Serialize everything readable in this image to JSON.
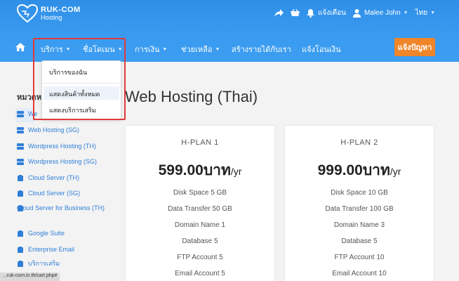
{
  "brand": {
    "name": "RUK-COM",
    "sub": "Hosting"
  },
  "topbar": {
    "notify_label": "แจ้งเตือน",
    "user_name": "Malee John",
    "language": "ไทย"
  },
  "nav": {
    "items": [
      {
        "label": "บริการ"
      },
      {
        "label": "ชื่อโดเมน"
      },
      {
        "label": "การเงิน"
      },
      {
        "label": "ช่วยเหลือ"
      },
      {
        "label": "สร้างรายได้กับเรา"
      },
      {
        "label": "แจ้งโอนเงิน"
      }
    ],
    "cta_label": "แจ้งปัญหา"
  },
  "dropdown": {
    "items": [
      {
        "label": "บริการของฉัน"
      },
      {
        "label": "แสดงสินค้าทั้งหมด"
      },
      {
        "label": "แสดงบริการเสริม"
      }
    ]
  },
  "sidebar": {
    "title": "หมวดหมู่",
    "items": [
      {
        "label": "We"
      },
      {
        "label": "Web Hosting (SG)"
      },
      {
        "label": "Wordpress Hosting (TH)"
      },
      {
        "label": "Wordpress Hosting (SG)"
      },
      {
        "label": "Cloud Server (TH)"
      },
      {
        "label": "Cloud Server (SG)"
      },
      {
        "label": "Cloud Server for Business (TH)"
      },
      {
        "label": "Google Suite"
      },
      {
        "label": "Enterprise Email"
      },
      {
        "label": "บริการเสริม"
      }
    ]
  },
  "main": {
    "title": "Web Hosting (Thai)",
    "plans": [
      {
        "name": "H-PLAN 1",
        "price": "599.00บาท",
        "period": "/yr",
        "features": [
          "Disk Space 5 GB",
          "Data Transfer 50 GB",
          "Domain Name 1",
          "Database 5",
          "FTP Account 5",
          "Email Account 5"
        ]
      },
      {
        "name": "H-PLAN 2",
        "price": "999.00บาท",
        "period": "/yr",
        "features": [
          "Disk Space 10 GB",
          "Data Transfer 100 GB",
          "Domain Name 3",
          "Database 5",
          "FTP Account 10",
          "Email Account 10"
        ]
      }
    ]
  },
  "statusbar": {
    "url": "...ruk-com.in.th/cart.php#"
  },
  "colors": {
    "header": "#3a9bf0",
    "cta": "#f0852a",
    "link": "#2f7fd8",
    "highlight_box": "#e03a3a"
  }
}
